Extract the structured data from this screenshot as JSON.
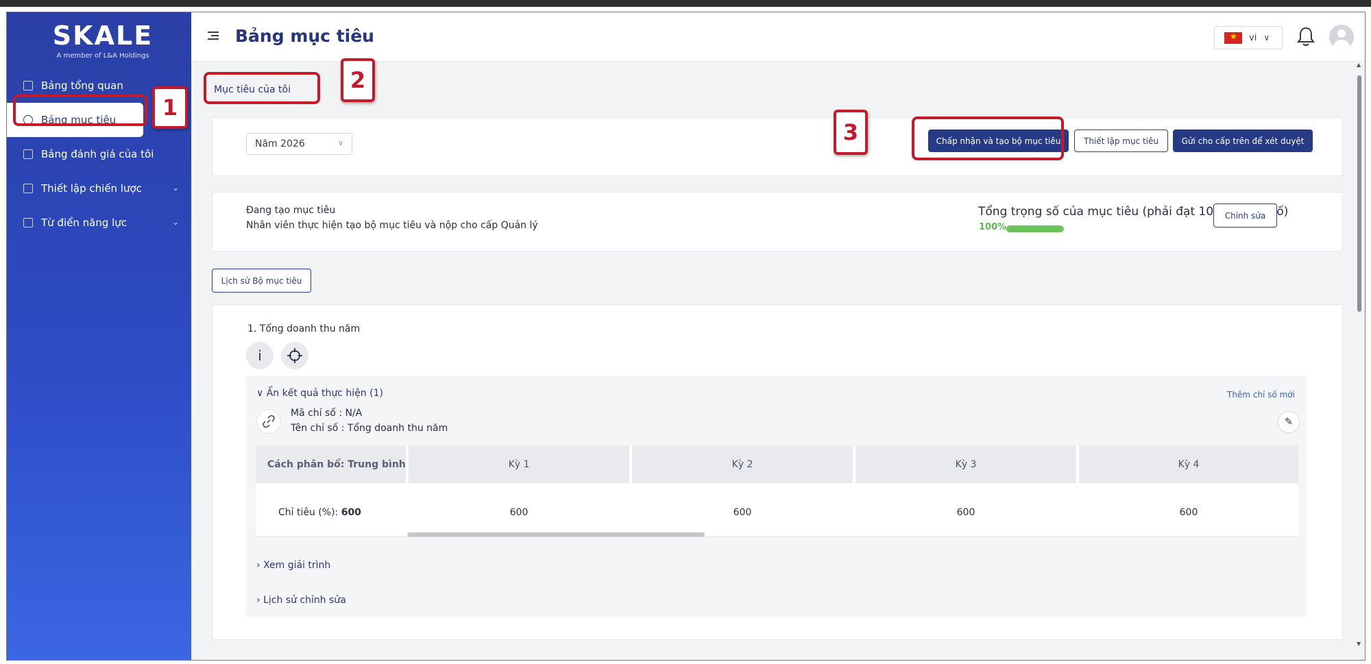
{
  "brand": {
    "logo_text": "SKALE",
    "logo_sub": "A member of L&A Holdings"
  },
  "sidebar": {
    "items": [
      {
        "label": "Bảng tổng quan",
        "icon": "dashboard-icon",
        "active": false
      },
      {
        "label": "Bảng mục tiêu",
        "icon": "gauge-icon",
        "active": true
      },
      {
        "label": "Bảng đánh giá của tôi",
        "icon": "table-icon",
        "active": false
      },
      {
        "label": "Thiết lập chiến lược",
        "icon": "flag-icon",
        "active": false,
        "has_children": true
      },
      {
        "label": "Từ điển năng lực",
        "icon": "book-icon",
        "active": false,
        "has_children": true
      }
    ]
  },
  "header": {
    "title": "Bảng mục tiêu",
    "language": "vi"
  },
  "tabs": {
    "mine": "Mục tiêu của tôi"
  },
  "toolbar": {
    "year": "Năm 2026",
    "accept_label": "Chấp nhận và tạo bộ mục tiêu",
    "setup_label": "Thiết lập mục tiêu",
    "send_label": "Gửi cho cấp trên để xét duyệt"
  },
  "status": {
    "title": "Đang tạo mục tiêu",
    "description": "Nhân viên thực hiện tạo bộ mục tiêu và nộp cho cấp Quản lý",
    "weight_label": "Tổng trọng số của mục tiêu  (phải đạt 100% trọng số)",
    "weight_pct_text": "100%",
    "weight_pct": 100,
    "edit_label": "Chỉnh sửa"
  },
  "history_label": "Lịch sử Bộ mục tiêu",
  "goal": {
    "title": "1. Tổng doanh thu năm",
    "info_glyph": "i",
    "results_toggle": "Ẩn kết quả thực hiện (1)",
    "add_metric": "Thêm chỉ số mới",
    "metric_code": "Mã chỉ số  : N/A",
    "metric_name": "Tên chỉ số : Tổng doanh thu năm",
    "table": {
      "first_header": "Cách phân bổ: Trung bình",
      "periods": [
        "Kỳ 1",
        "Kỳ 2",
        "Kỳ 3",
        "Kỳ 4"
      ],
      "target_label": "Chỉ tiêu (%):",
      "target_value": "600",
      "values": [
        "600",
        "600",
        "600",
        "600"
      ]
    },
    "explanation_toggle": "Xem giải trình",
    "edit_history_toggle": "Lịch sử chỉnh sửa"
  },
  "annotations": [
    "1",
    "2",
    "3"
  ],
  "colors": {
    "sidebar_top": "#2b3fa5",
    "primary": "#263a85",
    "accent_red": "#c41a2a",
    "progress": "#6ac45a"
  }
}
